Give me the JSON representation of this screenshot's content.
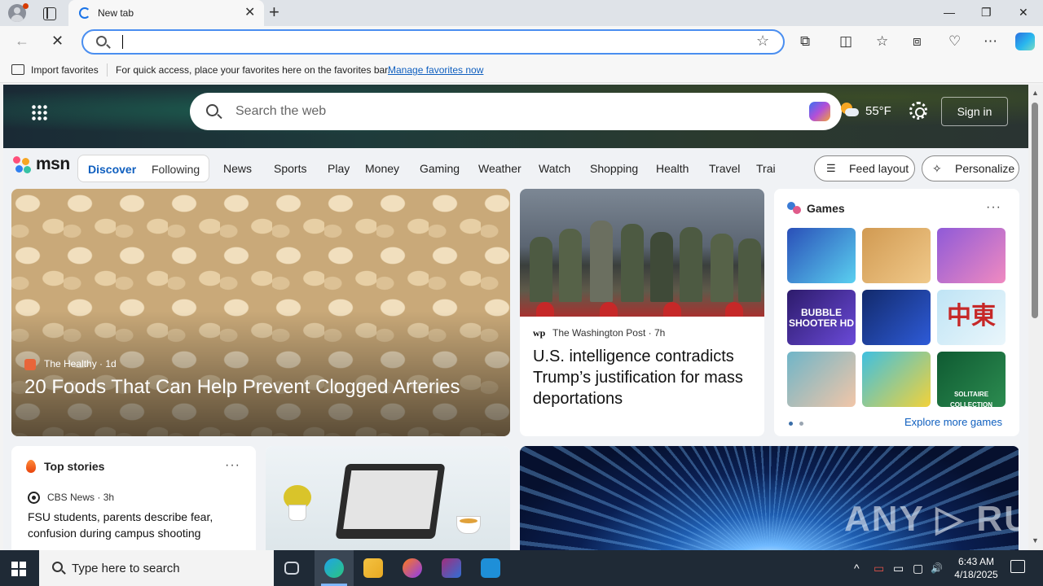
{
  "browser": {
    "tab_title": "New tab",
    "tab_close": "✕",
    "new_tab": "+",
    "window_controls": {
      "minimize": "—",
      "restore": "❐",
      "close": "✕"
    },
    "nav": {
      "back": "←",
      "stop": "✕"
    },
    "address_star": "☆",
    "toolbar_icons": {
      "extensions": "⧉",
      "split": "◫",
      "favorites": "☆",
      "collections": "⧈",
      "performance": "♡",
      "more": "⋯"
    },
    "favorites_bar": {
      "import_label": "Import favorites",
      "hint": "For quick access, place your favorites here on the favorites bar.",
      "manage_link": "Manage favorites now"
    }
  },
  "msn": {
    "search_placeholder": "Search the web",
    "weather_temp": "55°F",
    "sign_in": "Sign in",
    "logo_text": "msn",
    "logo_colors": [
      "#ff4f7a",
      "#f6a623",
      "#2f7ff0",
      "#37c2a4"
    ],
    "feed_tabs": {
      "discover": "Discover",
      "following": "Following"
    },
    "nav_links": [
      "News",
      "Sports",
      "Play",
      "Money",
      "Gaming",
      "Weather",
      "Watch",
      "Shopping",
      "Health",
      "Travel",
      "Trai"
    ],
    "feed_layout": "Feed layout",
    "personalize": "Personalize",
    "hero_article": {
      "source": "The Healthy",
      "age": "1d",
      "source_color": "#e8653a",
      "title": "20 Foods That Can Help Prevent Clogged Arteries"
    },
    "news_article": {
      "logo": "wp",
      "source": "The Washington Post",
      "age": "7h",
      "title": "U.S. intelligence contradicts Trump’s justification for mass deportations"
    },
    "games": {
      "title": "Games",
      "tiles": [
        {
          "name": "gem-puzzle",
          "label": "",
          "colors": [
            "#2a4fb8",
            "#5ad0f0"
          ]
        },
        {
          "name": "wood-screw",
          "label": "",
          "colors": [
            "#d19a52",
            "#f0c98a"
          ]
        },
        {
          "name": "makeup",
          "label": "",
          "colors": [
            "#8f5ad8",
            "#f08ac0"
          ]
        },
        {
          "name": "bubble-shooter",
          "label": "BUBBLE SHOOTER HD",
          "colors": [
            "#2d1b6b",
            "#6a4ad8"
          ]
        },
        {
          "name": "block-puzzle",
          "label": "",
          "colors": [
            "#122a6b",
            "#2e5bd8"
          ]
        },
        {
          "name": "mahjong",
          "label": "中東",
          "colors": [
            "#bfe4f5",
            "#eaf6fb"
          ]
        },
        {
          "name": "doctor-game",
          "label": "",
          "colors": [
            "#6fb5c8",
            "#f2c6a8"
          ]
        },
        {
          "name": "crazy-games",
          "label": "",
          "colors": [
            "#3fc0e0",
            "#f2d23a"
          ]
        },
        {
          "name": "solitaire",
          "label": "SOLITAIRE COLLECTION",
          "colors": [
            "#0f5a32",
            "#2c8c50"
          ]
        }
      ],
      "page_dots": {
        "active": "#3a6ea8",
        "inactive": "#9aa5b1"
      },
      "explore": "Explore more games"
    },
    "top_stories": {
      "title": "Top stories",
      "source": "CBS News",
      "age": "3h",
      "headline": "FSU students, parents describe fear, confusion during campus shooting"
    },
    "more": "···",
    "watermark": "ANY ▷ RUN"
  },
  "taskbar": {
    "search_placeholder": "Type here to search",
    "time": "6:43 AM",
    "date": "4/18/2025",
    "apps": [
      {
        "name": "task-view",
        "colors": [
          "#d0d6de",
          "#d0d6de"
        ]
      },
      {
        "name": "edge",
        "colors": [
          "#1fa3e8",
          "#2ac57e"
        ]
      },
      {
        "name": "file-explorer",
        "colors": [
          "#f4c242",
          "#e8a922"
        ]
      },
      {
        "name": "firefox",
        "colors": [
          "#ff7a1a",
          "#8d3cf0"
        ]
      },
      {
        "name": "winrar",
        "colors": [
          "#a12f7c",
          "#2f6fd6"
        ]
      },
      {
        "name": "cmd-tool",
        "colors": [
          "#1e8fd8",
          "#1e8fd8"
        ]
      }
    ],
    "tray": {
      "chevron": "^",
      "battery": "▭",
      "network": "▢",
      "volume": "🔊"
    }
  }
}
